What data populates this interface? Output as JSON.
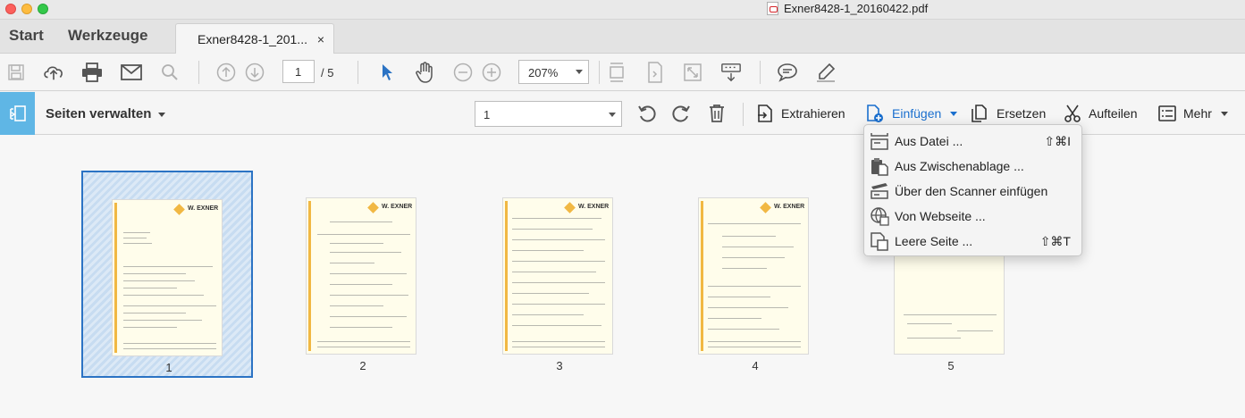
{
  "window": {
    "title": "Exner8428-1_20160422.pdf"
  },
  "tabs": {
    "start": "Start",
    "tools": "Werkzeuge",
    "document": "Exner8428-1_201...",
    "close": "×"
  },
  "toolbar": {
    "current_page": "1",
    "total_pages": "/ 5",
    "zoom": "207%",
    "accent": "#2b73c4"
  },
  "organize": {
    "title": "Seiten verwalten",
    "page_select": "1",
    "buttons": {
      "extract": "Extrahieren",
      "insert": "Einfügen",
      "replace": "Ersetzen",
      "split": "Aufteilen",
      "more": "Mehr"
    }
  },
  "insert_menu": {
    "items": [
      {
        "label": "Aus Datei ...",
        "shortcut": "⇧⌘I",
        "icon": "file-insert-icon"
      },
      {
        "label": "Aus Zwischenablage ...",
        "shortcut": "",
        "icon": "clipboard-icon"
      },
      {
        "label": "Über den Scanner einfügen",
        "shortcut": "",
        "icon": "scanner-icon"
      },
      {
        "label": "Von Webseite ...",
        "shortcut": "",
        "icon": "globe-icon"
      },
      {
        "label": "Leere Seite ...",
        "shortcut": "⇧⌘T",
        "icon": "blank-page-icon"
      }
    ]
  },
  "pages": [
    {
      "number": "1",
      "selected": true,
      "logo": "W. EXNER"
    },
    {
      "number": "2",
      "selected": false,
      "logo": "W. EXNER"
    },
    {
      "number": "3",
      "selected": false,
      "logo": "W. EXNER"
    },
    {
      "number": "4",
      "selected": false,
      "logo": "W. EXNER"
    },
    {
      "number": "5",
      "selected": false,
      "logo": ""
    }
  ]
}
